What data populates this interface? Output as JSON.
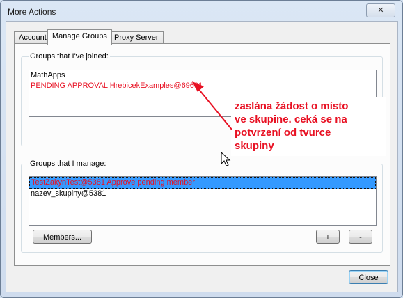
{
  "window": {
    "title": "More Actions",
    "close_glyph": "✕"
  },
  "tabs": [
    {
      "label": "Account"
    },
    {
      "label": "Manage Groups"
    },
    {
      "label": "Proxy Server"
    }
  ],
  "joined": {
    "label": "Groups that I've joined:",
    "items": [
      {
        "text": "MathApps"
      },
      {
        "text": "PENDING APPROVAL HrebicekExamples@69691"
      }
    ]
  },
  "managed": {
    "label": "Groups that I manage:",
    "items": [
      {
        "text": "TestZakynTest@5381 Approve pending member"
      },
      {
        "text": "nazev_skupiny@5381"
      }
    ],
    "members_button": "Members...",
    "add_button": "+",
    "remove_button": "-"
  },
  "close_button": "Close",
  "annotation": {
    "lines": [
      "zaslána žádost o místo",
      "ve skupine. ceká se na",
      "potvrzení od tvurce",
      "skupiny"
    ],
    "color": "#e81123"
  }
}
